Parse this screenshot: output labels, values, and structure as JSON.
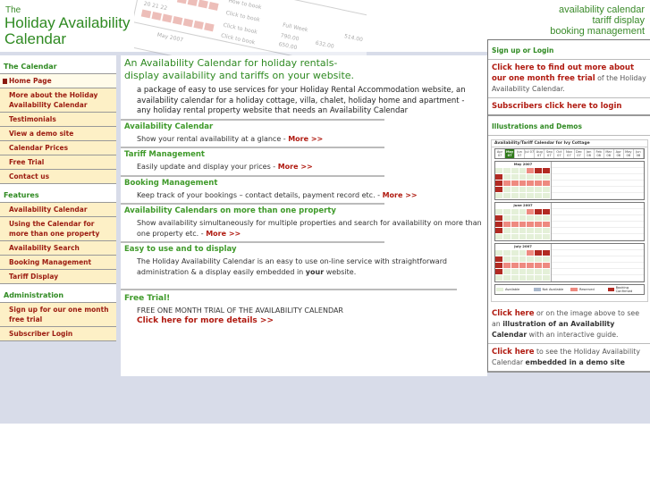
{
  "header": {
    "logo_the": "The",
    "logo_line1": "Holiday Availability",
    "logo_line2": "Calendar",
    "tagline": [
      "availability calendar",
      "tariff display",
      "booking management"
    ]
  },
  "sidebar": {
    "sections": [
      {
        "title": "The Calendar",
        "items": [
          "Home Page",
          "More about the Holiday Availability Calendar",
          "Testimonials",
          "View a demo site",
          "Calendar Prices",
          "Free Trial",
          "Contact us"
        ]
      },
      {
        "title": "Features",
        "items": [
          "Availability Calendar",
          "Using the Calendar for more than one property",
          "Availability Search",
          "Booking Management",
          "Tariff Display"
        ]
      },
      {
        "title": "Administration",
        "items": [
          "Sign up for our one month free trial",
          "Subscriber Login"
        ]
      }
    ]
  },
  "main": {
    "intro_title_1": "An Availability Calendar for holiday rentals-",
    "intro_title_2": "display availability and tariffs on your website.",
    "intro_body": "a package of easy to use services for your Holiday Rental Accommodation website, an availability calendar for a holiday cottage, villa, chalet, holiday home and apartment - any holiday rental property website that needs an Availability Calendar",
    "sections": [
      {
        "title": "Availability Calendar",
        "body": "Show your rental availability at a glance - ",
        "more": "More >>"
      },
      {
        "title": "Tariff Management",
        "body": "Easily update and display your prices - ",
        "more": "More >>"
      },
      {
        "title": "Booking Management",
        "body": "Keep track of your bookings – contact details, payment record etc. - ",
        "more": "More >>"
      },
      {
        "title": "Availability Calendars on more than one property",
        "body": "Show availability simultaneously for multiple properties and search for availability on more than one property etc. - ",
        "more": "More >>"
      }
    ],
    "easy": {
      "title": "Easy to use and to display",
      "body_a": "The Holiday Availability Calendar is an easy to use on-line service with straightforward administration & a display easily embedded in ",
      "body_bold": "your",
      "body_b": " website."
    },
    "trial": {
      "title": "Free Trial!",
      "body": "FREE ONE MONTH TRIAL OF THE AVAILABILITY CALENDAR",
      "link": "Click here for more details >>"
    }
  },
  "right": {
    "signup_title": "Sign up or Login",
    "signup_link": "Click here to find out more about our one month free trial",
    "signup_rest": " of the Holiday Availability Calendar.",
    "login_link": "Subscribers click here to login",
    "illus_title": "Illustrations and Demos",
    "demo": {
      "title": "Availability/Tariff Calendar for Ivy Cottage",
      "months": [
        "Apr 07",
        "May 07",
        "Jun 07",
        "Jul 07",
        "Aug 07",
        "Sep 07",
        "Oct 07",
        "Nov 07",
        "Dec 07",
        "Jan 08",
        "Feb 08",
        "Mar 08",
        "Apr 08",
        "May 08",
        "Jun 08"
      ],
      "blocks": [
        "May 2007",
        "June 2007",
        "July 2007"
      ],
      "legend": [
        "Available",
        "Not Available",
        "Reserved",
        "Booking Confirmed"
      ],
      "colors": {
        "available": "#e4f0d8",
        "not_available": "#a9b8cc",
        "reserved": "#ee8a80",
        "confirmed": "#b22a22"
      }
    },
    "click1_link": "Click here",
    "click1_a": " or on the image above to see an ",
    "click1_bold": "illustration of an Availability Calendar",
    "click1_b": " with an interactive guide.",
    "click2_link": "Click here",
    "click2_a": " to see the Holiday Availability Calendar ",
    "click2_bold": "embedded in a demo site"
  },
  "colors": {
    "brand_green": "#2f8a22",
    "link_red": "#b01a10",
    "nav_bg": "#fdf0c6",
    "band": "#d8dce9"
  }
}
